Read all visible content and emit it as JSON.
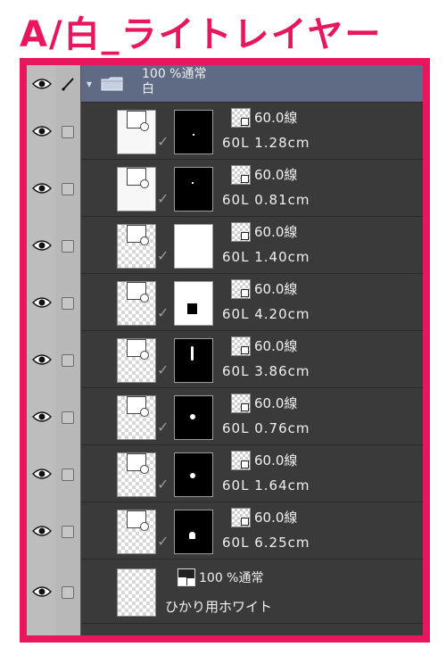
{
  "heading": "A/白_ライトレイヤー",
  "colors": {
    "accent": "#e8175d",
    "panel_bg": "#3a3a3a",
    "folder_bg": "#5f6b84"
  },
  "icons": {
    "visibility": "eye-icon",
    "lock": "checkbox",
    "edit": "pen-icon",
    "folder": "folder-icon"
  },
  "folder": {
    "blend": "100 %通常",
    "name": "白"
  },
  "layers": [
    {
      "opacity": "60.0線",
      "info": "60L 1.28cm",
      "mask": "black"
    },
    {
      "opacity": "60.0線",
      "info": "60L 0.81cm",
      "mask": "black"
    },
    {
      "opacity": "60.0線",
      "info": "60L 1.40cm",
      "mask": "white"
    },
    {
      "opacity": "60.0線",
      "info": "60L 4.20cm",
      "mask": "white"
    },
    {
      "opacity": "60.0線",
      "info": "60L 3.86cm",
      "mask": "black"
    },
    {
      "opacity": "60.0線",
      "info": "60L 0.76cm",
      "mask": "black"
    },
    {
      "opacity": "60.0線",
      "info": "60L 1.64cm",
      "mask": "black"
    },
    {
      "opacity": "60.0線",
      "info": "60L 6.25cm",
      "mask": "black"
    }
  ],
  "last_layer": {
    "blend": "100 %通常",
    "name": "ひかり用ホワイト"
  }
}
